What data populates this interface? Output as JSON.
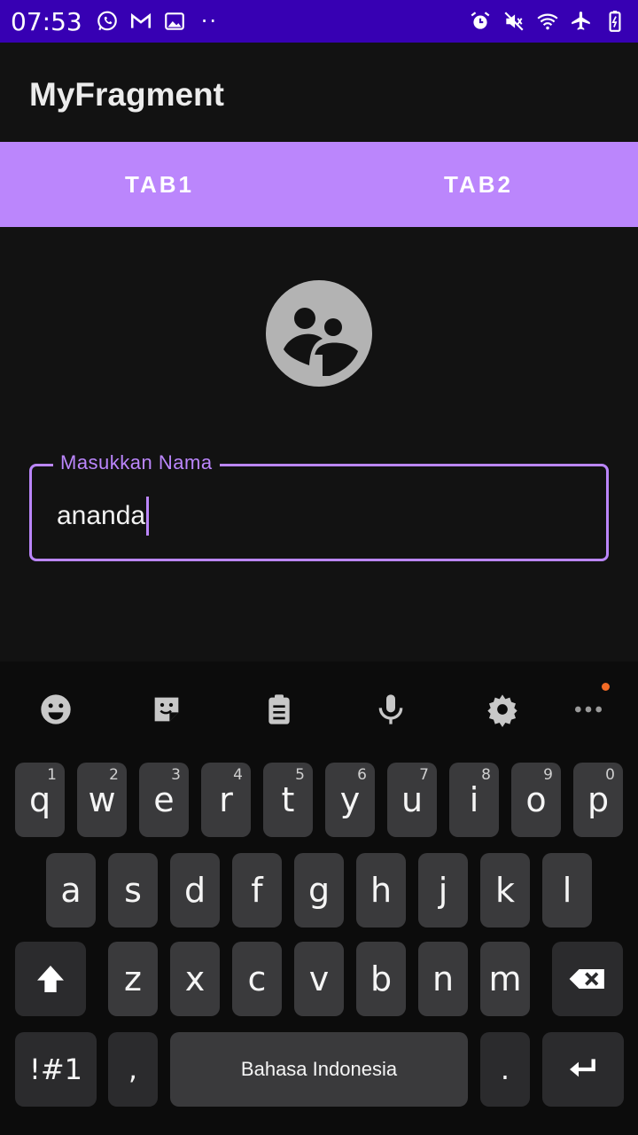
{
  "status_bar": {
    "time": "07:53",
    "left_icons": [
      "whatsapp-icon",
      "gmail-icon",
      "gallery-icon"
    ],
    "more_dots": "··",
    "right_icons": [
      "alarm-icon",
      "mute-icon",
      "wifi-icon",
      "airplane-icon",
      "battery-icon"
    ]
  },
  "app_bar": {
    "title": "MyFragment"
  },
  "tabs": [
    {
      "label": "TAB1"
    },
    {
      "label": "TAB2"
    }
  ],
  "avatar": {
    "icon": "group-people-icon"
  },
  "name_field": {
    "label": "Masukkan Nama",
    "value": "ananda"
  },
  "keyboard": {
    "toolbar": [
      "emoji-icon",
      "sticker-icon",
      "clipboard-icon",
      "microphone-icon",
      "settings-icon",
      "more-icon"
    ],
    "row1": [
      {
        "char": "q",
        "hint": "1"
      },
      {
        "char": "w",
        "hint": "2"
      },
      {
        "char": "e",
        "hint": "3"
      },
      {
        "char": "r",
        "hint": "4"
      },
      {
        "char": "t",
        "hint": "5"
      },
      {
        "char": "y",
        "hint": "6"
      },
      {
        "char": "u",
        "hint": "7"
      },
      {
        "char": "i",
        "hint": "8"
      },
      {
        "char": "o",
        "hint": "9"
      },
      {
        "char": "p",
        "hint": "0"
      }
    ],
    "row2": [
      "a",
      "s",
      "d",
      "f",
      "g",
      "h",
      "j",
      "k",
      "l"
    ],
    "row3": [
      "z",
      "x",
      "c",
      "v",
      "b",
      "n",
      "m"
    ],
    "symbols_label": "!#1",
    "comma_label": ",",
    "space_label": "Bahasa Indonesia",
    "period_label": "."
  },
  "colors": {
    "accent": "#BB86FC",
    "status_bar": "#3700B3",
    "background": "#121212",
    "badge": "#F26A25"
  }
}
